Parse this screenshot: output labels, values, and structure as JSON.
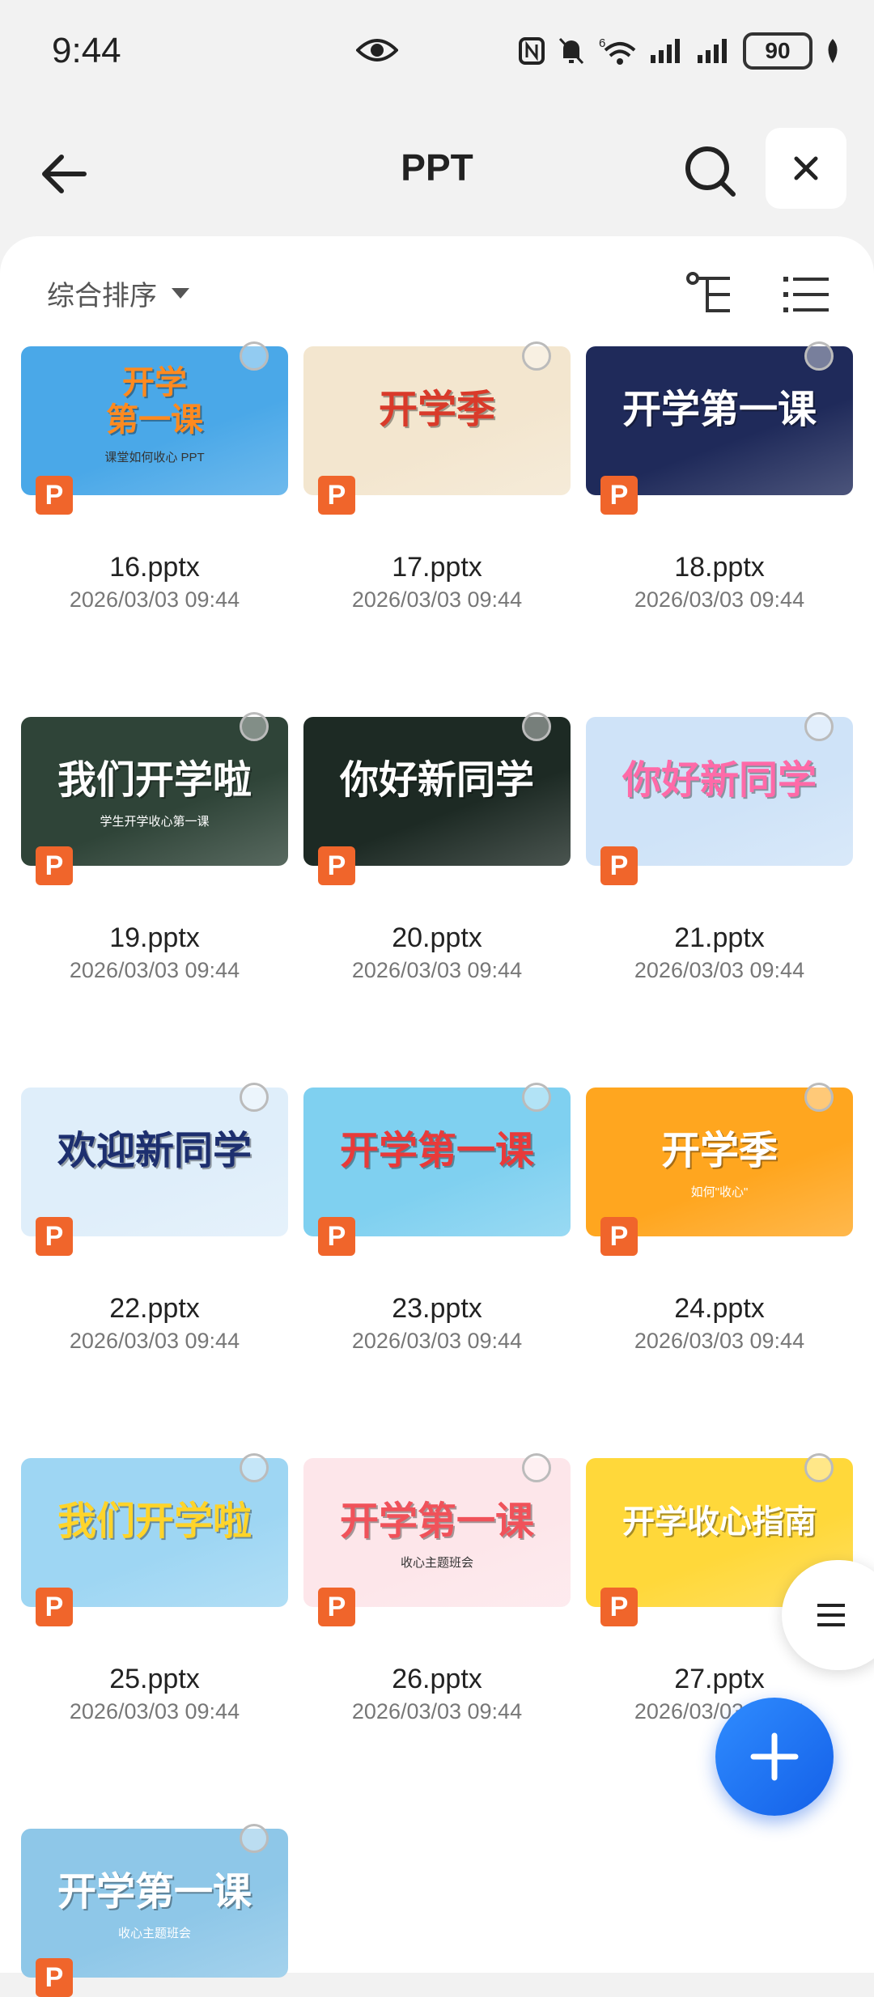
{
  "status_bar": {
    "time": "9:44",
    "network": "6",
    "battery": "90"
  },
  "header": {
    "title": "PPT"
  },
  "toolbar": {
    "sort_label": "综合排序"
  },
  "files": [
    {
      "name": "16.pptx",
      "date": "2026/03/03 09:44",
      "thumb_title": "开学\n第一课",
      "thumb_sub": "课堂如何收心 PPT",
      "bg": "#4aa8e8",
      "fg": "#ff8a1f"
    },
    {
      "name": "17.pptx",
      "date": "2026/03/03 09:44",
      "thumb_title": "开学季",
      "thumb_sub": "",
      "bg": "#f3e6cf",
      "fg": "#d93a2a"
    },
    {
      "name": "18.pptx",
      "date": "2026/03/03 09:44",
      "thumb_title": "开学第一课",
      "thumb_sub": "",
      "bg": "#1f2a5a",
      "fg": "#ffffff"
    },
    {
      "name": "19.pptx",
      "date": "2026/03/03 09:44",
      "thumb_title": "我们开学啦",
      "thumb_sub": "学生开学收心第一课",
      "bg": "#2f4438",
      "fg": "#ffffff"
    },
    {
      "name": "20.pptx",
      "date": "2026/03/03 09:44",
      "thumb_title": "你好新同学",
      "thumb_sub": "",
      "bg": "#1d2a24",
      "fg": "#ffffff"
    },
    {
      "name": "21.pptx",
      "date": "2026/03/03 09:44",
      "thumb_title": "你好新同学",
      "thumb_sub": "",
      "bg": "#cfe3f8",
      "fg": "#ff6aa8"
    },
    {
      "name": "22.pptx",
      "date": "2026/03/03 09:44",
      "thumb_title": "欢迎新同学",
      "thumb_sub": "",
      "bg": "#dfeefa",
      "fg": "#1d2f6f"
    },
    {
      "name": "23.pptx",
      "date": "2026/03/03 09:44",
      "thumb_title": "开学第一课",
      "thumb_sub": "",
      "bg": "#7fd0f0",
      "fg": "#e83a3a"
    },
    {
      "name": "24.pptx",
      "date": "2026/03/03 09:44",
      "thumb_title": "开学季",
      "thumb_sub": "如何\"收心\"",
      "bg": "#ffa61f",
      "fg": "#ffffff"
    },
    {
      "name": "25.pptx",
      "date": "2026/03/03 09:44",
      "thumb_title": "我们开学啦",
      "thumb_sub": "",
      "bg": "#9ed6f3",
      "fg": "#ffd42a"
    },
    {
      "name": "26.pptx",
      "date": "2026/03/03 09:44",
      "thumb_title": "开学第一课",
      "thumb_sub": "收心主题班会",
      "bg": "#fde6ea",
      "fg": "#f0525a"
    },
    {
      "name": "27.pptx",
      "date": "2026/03/03 09:44",
      "thumb_title": "开学收心指南",
      "thumb_sub": "",
      "bg": "#ffd83a",
      "fg": "#ffffff"
    },
    {
      "name": "",
      "date": "",
      "thumb_title": "开学第一课",
      "thumb_sub": "收心主题班会",
      "bg": "#8ec7e8",
      "fg": "#ffffff"
    }
  ],
  "colors": {
    "accent": "#1e74f0",
    "ppt_badge": "#f0652b",
    "badge_letter": "P"
  }
}
